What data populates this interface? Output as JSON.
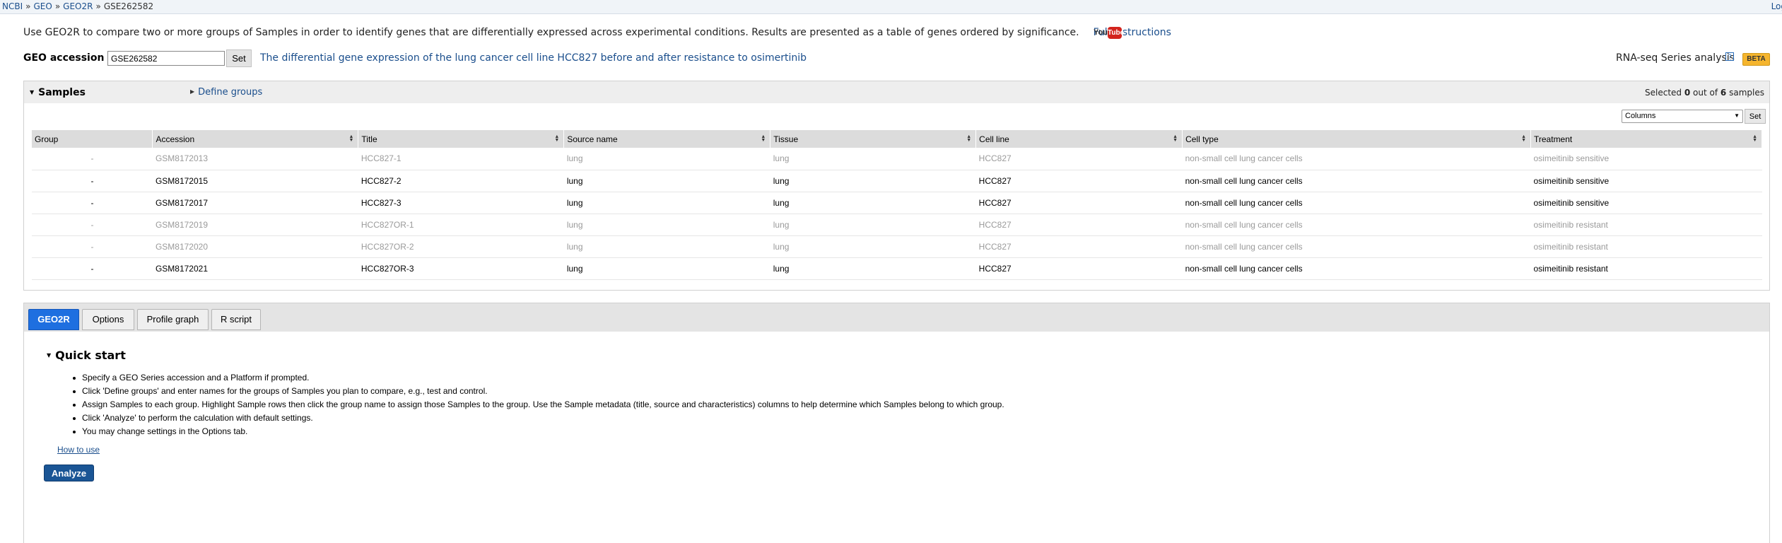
{
  "breadcrumb": {
    "items": [
      "NCBI",
      "GEO",
      "GEO2R"
    ],
    "current": "GSE262582",
    "login": "Log"
  },
  "intro": {
    "text": "Use GEO2R to compare two or more groups of Samples in order to identify genes that are differentially expressed across experimental conditions. Results are presented as a table of genes ordered by significance.",
    "full_instructions": "Full instructions",
    "youtube_icon": "youtube-icon"
  },
  "accession": {
    "label": "GEO accession",
    "value": "GSE262582",
    "set_label": "Set",
    "series_title": "The differential gene expression of the lung cancer cell line HCC827 before and after resistance to osimertinib",
    "analysis_type": "RNA-seq Series analysis",
    "help_icon": "?",
    "beta": "BETA"
  },
  "samples": {
    "title": "Samples",
    "define_groups": "Define groups",
    "selected_prefix": "Selected",
    "selected_count": "0",
    "selected_mid": "out of",
    "total_count": "6",
    "selected_suffix": "samples",
    "columns_select": "Columns",
    "columns_set": "Set",
    "headers": [
      "Group",
      "Accession",
      "Title",
      "Source name",
      "Tissue",
      "Cell line",
      "Cell type",
      "Treatment"
    ],
    "rows": [
      {
        "group": "-",
        "accession": "GSM8172013",
        "title": "HCC827-1",
        "source": "lung",
        "tissue": "lung",
        "cell_line": "HCC827",
        "cell_type": "non-small cell lung cancer cells",
        "treatment": "osimeitinib sensitive",
        "dim": true
      },
      {
        "group": "-",
        "accession": "GSM8172015",
        "title": "HCC827-2",
        "source": "lung",
        "tissue": "lung",
        "cell_line": "HCC827",
        "cell_type": "non-small cell lung cancer cells",
        "treatment": "osimeitinib sensitive",
        "dim": false
      },
      {
        "group": "-",
        "accession": "GSM8172017",
        "title": "HCC827-3",
        "source": "lung",
        "tissue": "lung",
        "cell_line": "HCC827",
        "cell_type": "non-small cell lung cancer cells",
        "treatment": "osimeitinib sensitive",
        "dim": false
      },
      {
        "group": "-",
        "accession": "GSM8172019",
        "title": "HCC827OR-1",
        "source": "lung",
        "tissue": "lung",
        "cell_line": "HCC827",
        "cell_type": "non-small cell lung cancer cells",
        "treatment": "osimeitinib resistant",
        "dim": true
      },
      {
        "group": "-",
        "accession": "GSM8172020",
        "title": "HCC827OR-2",
        "source": "lung",
        "tissue": "lung",
        "cell_line": "HCC827",
        "cell_type": "non-small cell lung cancer cells",
        "treatment": "osimeitinib resistant",
        "dim": true
      },
      {
        "group": "-",
        "accession": "GSM8172021",
        "title": "HCC827OR-3",
        "source": "lung",
        "tissue": "lung",
        "cell_line": "HCC827",
        "cell_type": "non-small cell lung cancer cells",
        "treatment": "osimeitinib resistant",
        "dim": false
      }
    ]
  },
  "tabs": {
    "items": [
      "GEO2R",
      "Options",
      "Profile graph",
      "R script"
    ],
    "active": "GEO2R"
  },
  "quick_start": {
    "title": "Quick start",
    "items": [
      "Specify a GEO Series accession and a Platform if prompted.",
      "Click 'Define groups' and enter names for the groups of Samples you plan to compare, e.g., test and control.",
      "Assign Samples to each group. Highlight Sample rows then click the group name to assign those Samples to the group. Use the Sample metadata (title, source and characteristics) columns to help determine which Samples belong to which group.",
      "Click 'Analyze' to perform the calculation with default settings.",
      "You may change settings in the Options tab."
    ],
    "how_to_use": "How to use",
    "analyze_label": "Analyze"
  }
}
